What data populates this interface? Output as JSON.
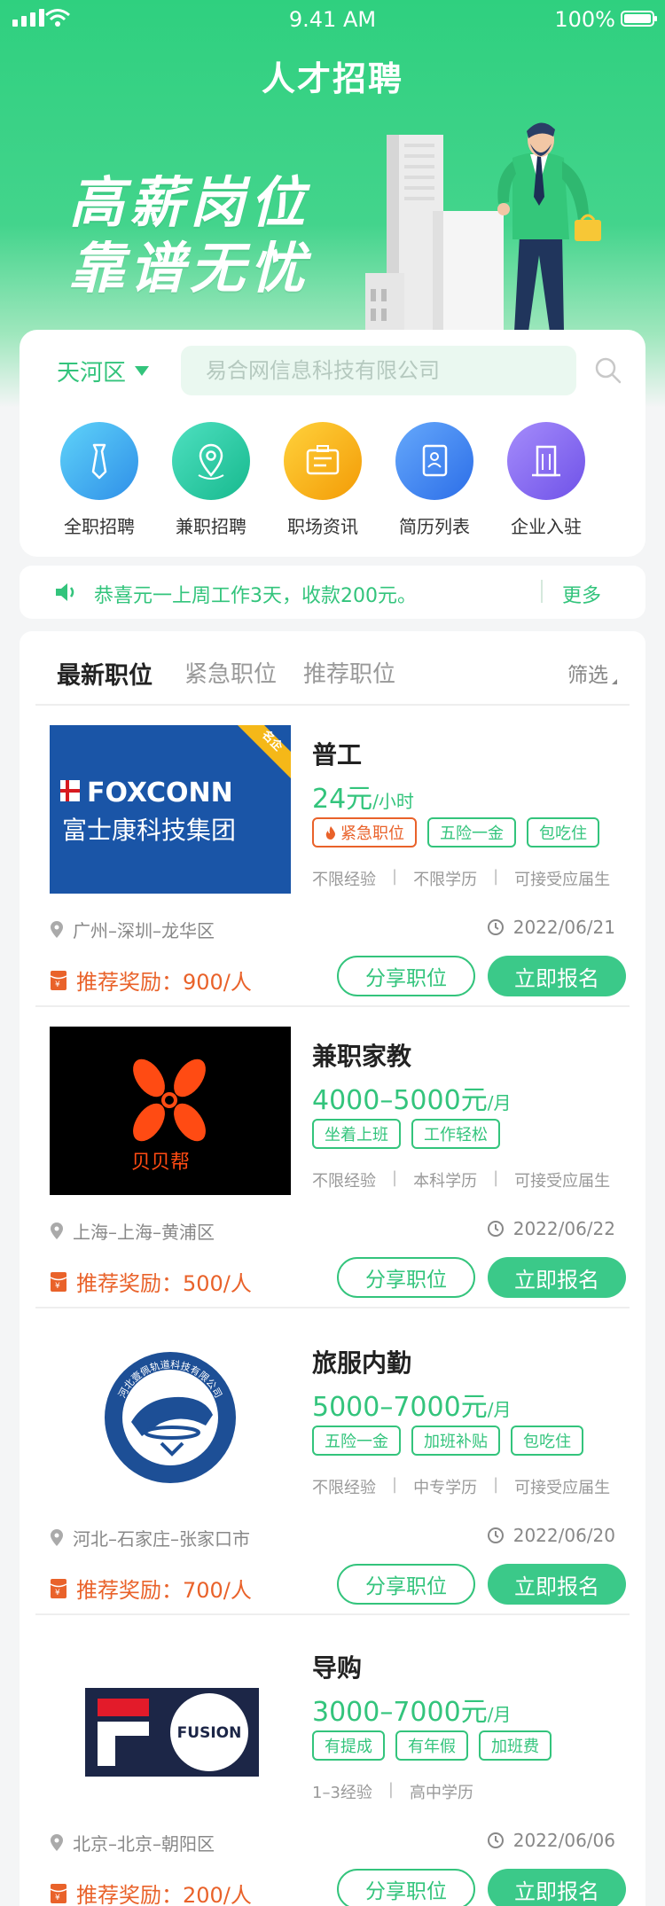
{
  "status_bar": {
    "time": "9.41 AM",
    "battery": "100%"
  },
  "header": {
    "title": "人才招聘"
  },
  "banner": {
    "line1": "高薪岗位",
    "line2": "靠谱无忧"
  },
  "search": {
    "district": "天河区",
    "placeholder": "易合网信息科技有限公司"
  },
  "categories": [
    {
      "label": "全职招聘",
      "icon": "tie-icon",
      "color": "#3aa8ee"
    },
    {
      "label": "兼职招聘",
      "icon": "location-pin-icon",
      "color": "#26c9a2"
    },
    {
      "label": "职场资讯",
      "icon": "news-card-icon",
      "color": "#f6aa12"
    },
    {
      "label": "简历列表",
      "icon": "resume-icon",
      "color": "#3f86f3"
    },
    {
      "label": "企业入驻",
      "icon": "building-icon",
      "color": "#8b6ef2"
    }
  ],
  "notice": {
    "text": "恭喜元一上周工作3天，收款200元。",
    "more": "更多"
  },
  "tabs": [
    "最新职位",
    "紧急职位",
    "推荐职位"
  ],
  "filter_label": "筛选",
  "actions": {
    "share": "分享职位",
    "apply": "立即报名"
  },
  "reward_label": "推荐奖励：",
  "jobs": [
    {
      "title": "普工",
      "salary": "24元",
      "unit": "/小时",
      "tags": [
        "紧急职位",
        "五险一金",
        "包吃住"
      ],
      "reqs": [
        "不限经验",
        "不限学历",
        "可接受应届生"
      ],
      "location": "广州–深圳–龙华区",
      "date": "2022/06/21",
      "reward": "900/人",
      "badge": "名企",
      "logo": {
        "name": "FOXCONN",
        "sub": "富士康科技集团"
      }
    },
    {
      "title": "兼职家教",
      "salary": "4000–5000元",
      "unit": "/月",
      "tags": [
        "坐着上班",
        "工作轻松"
      ],
      "reqs": [
        "不限经验",
        "本科学历",
        "可接受应届生"
      ],
      "location": "上海–上海–黄浦区",
      "date": "2022/06/22",
      "reward": "500/人",
      "logo": {
        "name": "贝贝帮"
      }
    },
    {
      "title": "旅服内勤",
      "salary": "5000–7000元",
      "unit": "/月",
      "tags": [
        "五险一金",
        "加班补贴",
        "包吃住"
      ],
      "reqs": [
        "不限经验",
        "中专学历",
        "可接受应届生"
      ],
      "location": "河北–石家庄–张家口市",
      "date": "2022/06/20",
      "reward": "700/人",
      "logo": {
        "name": "河北壹佩轨道科技有限公司"
      }
    },
    {
      "title": "导购",
      "salary": "3000–7000元",
      "unit": "/月",
      "tags": [
        "有提成",
        "有年假",
        "加班费"
      ],
      "reqs": [
        "1–3经验",
        "高中学历"
      ],
      "location": "北京–北京–朝阳区",
      "date": "2022/06/06",
      "reward": "200/人",
      "logo": {
        "name": "FUSION"
      }
    }
  ]
}
